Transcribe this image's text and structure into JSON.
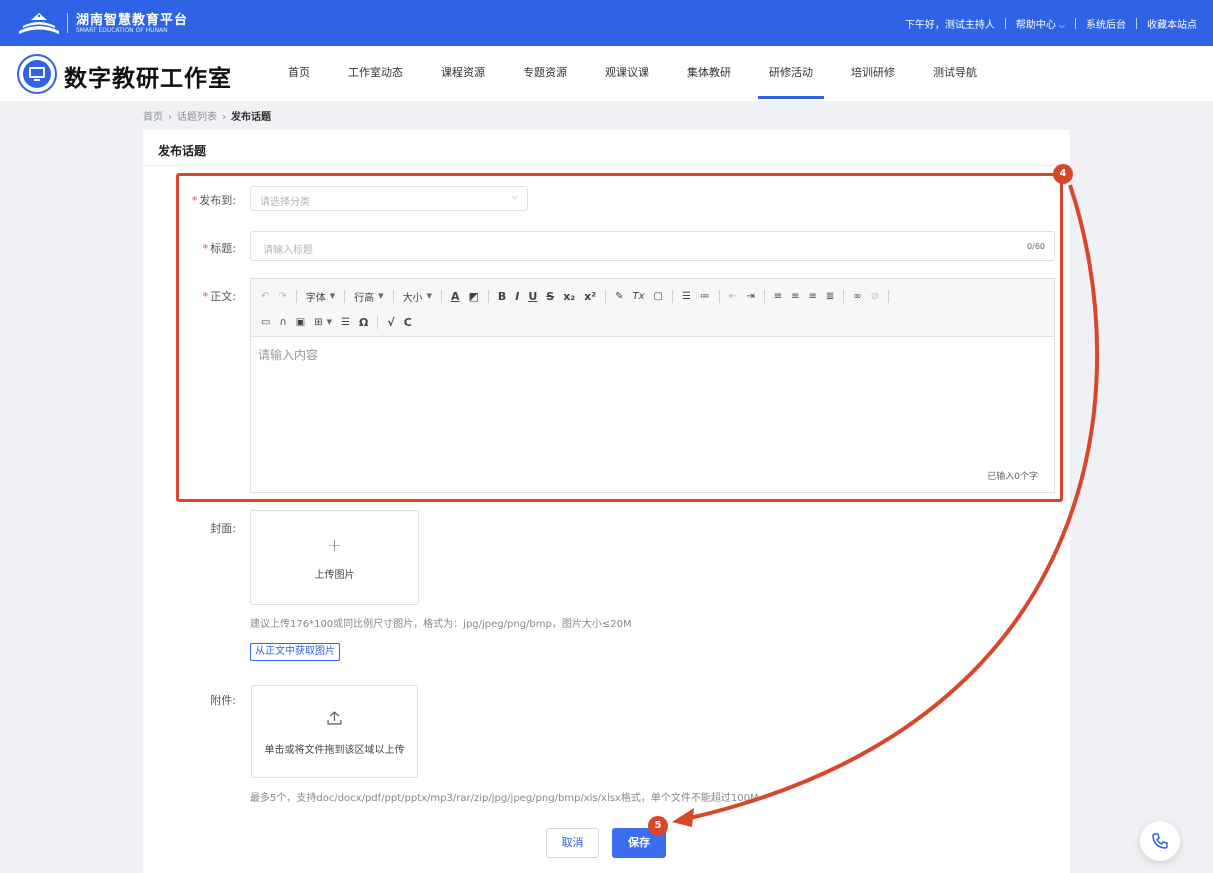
{
  "topbar": {
    "brand_cn": "湖南智慧教育平台",
    "brand_en": "SMART EDUCATION OF HUNAN",
    "greeting": "下午好，测试主持人",
    "help_center": "帮助中心",
    "system_backend": "系统后台",
    "bookmark_site": "收藏本站点"
  },
  "header": {
    "studio_name": "数字教研工作室",
    "nav": [
      {
        "label": "首页"
      },
      {
        "label": "工作室动态"
      },
      {
        "label": "课程资源"
      },
      {
        "label": "专题资源"
      },
      {
        "label": "观课议课"
      },
      {
        "label": "集体教研"
      },
      {
        "label": "研修活动",
        "active": true
      },
      {
        "label": "培训研修"
      },
      {
        "label": "测试导航"
      }
    ]
  },
  "breadcrumb": {
    "home": "首页",
    "list": "话题列表",
    "current": "发布话题"
  },
  "form": {
    "page_title": "发布话题",
    "publish_to_label": "发布到:",
    "publish_to_placeholder": "请选择分类",
    "title_label": "标题:",
    "title_placeholder": "请输入标题",
    "title_count": "0/60",
    "body_label": "正文:",
    "body_placeholder": "请输入内容",
    "word_count": "已输入0个字",
    "toolbar": {
      "font": "字体",
      "line_height": "行高",
      "size": "大小"
    },
    "cover_label": "封面:",
    "cover_upload": "上传图片",
    "cover_hint": "建议上传176*100或同比例尺寸图片，格式为：jpg/jpeg/png/bmp，图片大小≤20M",
    "from_body_button": "从正文中获取图片",
    "attachment_label": "附件:",
    "attachment_upload": "单击或将文件拖到该区域以上传",
    "attachment_hint": "最多5个，支持doc/docx/pdf/ppt/pptx/mp3/rar/zip/jpg/jpeg/png/bmp/xls/xlsx格式，单个文件不能超过100M",
    "cancel": "取消",
    "save": "保存"
  },
  "annotations": {
    "step4": "4",
    "step5": "5",
    "color": "#d9472b"
  },
  "colors": {
    "primary": "#2f63e6",
    "required": "#e64545"
  }
}
